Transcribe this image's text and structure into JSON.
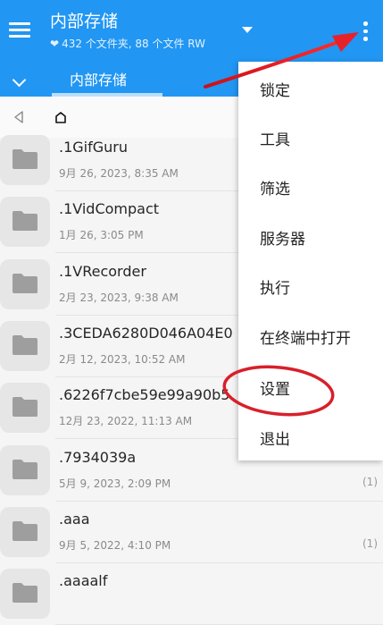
{
  "appbar": {
    "title": "内部存储",
    "subtitle": "432 个文件夹, 88 个文件 RW",
    "heart_glyph": "❤"
  },
  "tabs": [
    {
      "label": "内部存储"
    }
  ],
  "path": {
    "home_glyph": "⌂"
  },
  "files": [
    {
      "name": ".1GifGuru",
      "date": "9月 26, 2023, 8:35 AM",
      "count": ""
    },
    {
      "name": ".1VidCompact",
      "date": "1月 26, 3:05 PM",
      "count": ""
    },
    {
      "name": ".1VRecorder",
      "date": "2月 23, 2023, 9:38 AM",
      "count": ""
    },
    {
      "name": ".3CEDA6280D046A04E0",
      "date": "2月 12, 2023, 10:52 AM",
      "count": ""
    },
    {
      "name": ".6226f7cbe59e99a90b5",
      "date": "12月 23, 2022, 11:13 AM",
      "count": ""
    },
    {
      "name": ".7934039a",
      "date": "5月 9, 2023, 2:09 PM",
      "count": "(1)"
    },
    {
      "name": ".aaa",
      "date": "9月 5, 2022, 4:10 PM",
      "count": "(1)"
    },
    {
      "name": ".aaaalf",
      "date": "",
      "count": ""
    }
  ],
  "menu": {
    "items": [
      {
        "label": "锁定"
      },
      {
        "label": "工具"
      },
      {
        "label": "筛选"
      },
      {
        "label": "服务器"
      },
      {
        "label": "执行"
      },
      {
        "label": "在终端中打开"
      },
      {
        "label": "设置"
      },
      {
        "label": "退出"
      }
    ]
  },
  "annotations": {
    "arrow_color": "#e8202a",
    "circle_color": "#d8202a",
    "circled_item": "设置"
  },
  "colors": {
    "accent": "#2196f3",
    "menu_bg": "#ffffff",
    "folder_bg": "#e6e6e6"
  }
}
